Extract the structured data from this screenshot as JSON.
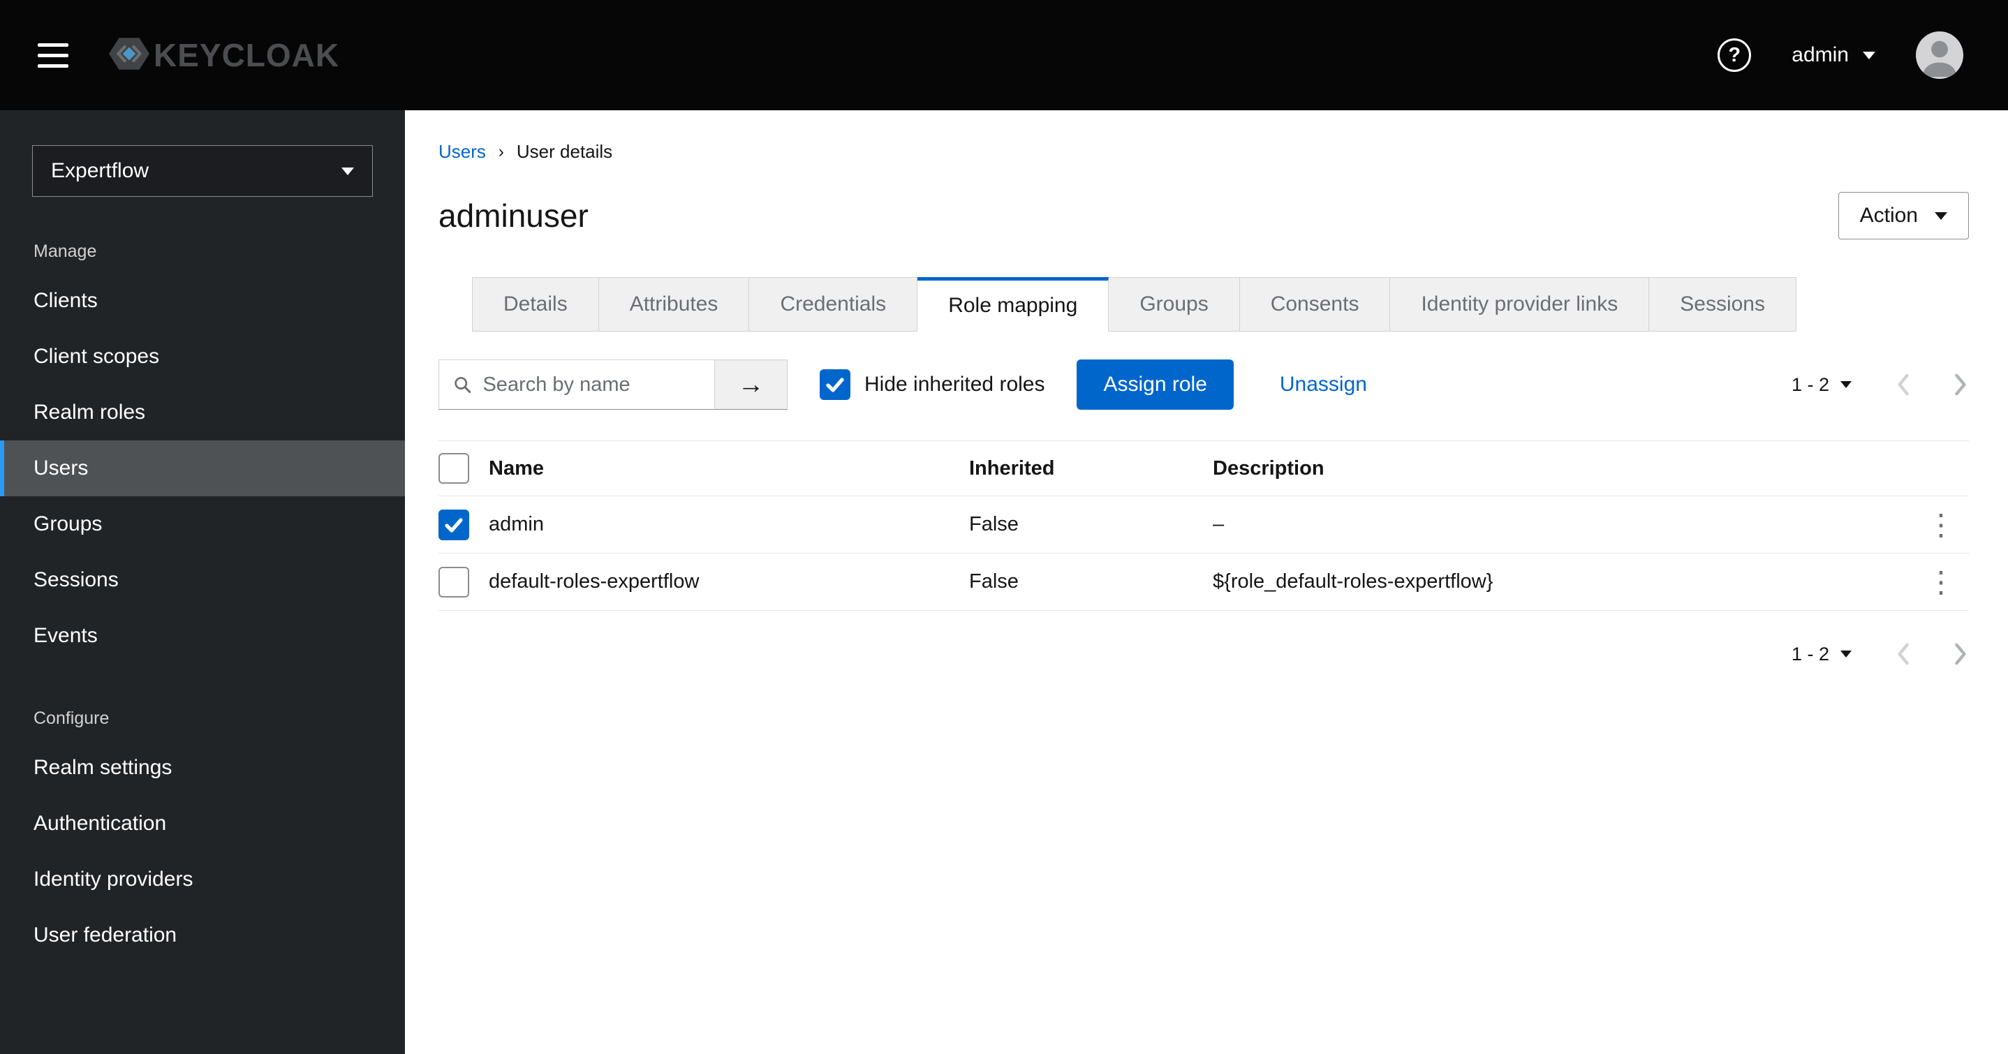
{
  "header": {
    "brand": "KEYCLOAK",
    "user": "admin"
  },
  "icons": {
    "help": "?",
    "search_submit": "→",
    "kebab": "⋮"
  },
  "sidebar": {
    "realm": "Expertflow",
    "sections": [
      {
        "label": "Manage",
        "items": [
          {
            "label": "Clients",
            "current": false
          },
          {
            "label": "Client scopes",
            "current": false
          },
          {
            "label": "Realm roles",
            "current": false
          },
          {
            "label": "Users",
            "current": true
          },
          {
            "label": "Groups",
            "current": false
          },
          {
            "label": "Sessions",
            "current": false
          },
          {
            "label": "Events",
            "current": false
          }
        ]
      },
      {
        "label": "Configure",
        "items": [
          {
            "label": "Realm settings",
            "current": false
          },
          {
            "label": "Authentication",
            "current": false
          },
          {
            "label": "Identity providers",
            "current": false
          },
          {
            "label": "User federation",
            "current": false
          }
        ]
      }
    ]
  },
  "breadcrumb": {
    "separator": "›",
    "items": [
      {
        "label": "Users",
        "link": true
      },
      {
        "label": "User details",
        "link": false
      }
    ]
  },
  "page": {
    "title": "adminuser",
    "action_button": "Action"
  },
  "tabs": [
    {
      "label": "Details",
      "active": false
    },
    {
      "label": "Attributes",
      "active": false
    },
    {
      "label": "Credentials",
      "active": false
    },
    {
      "label": "Role mapping",
      "active": true
    },
    {
      "label": "Groups",
      "active": false
    },
    {
      "label": "Consents",
      "active": false
    },
    {
      "label": "Identity provider links",
      "active": false
    },
    {
      "label": "Sessions",
      "active": false
    }
  ],
  "toolbar": {
    "search_placeholder": "Search by name",
    "hide_inherited": {
      "label": "Hide inherited roles",
      "checked": true
    },
    "assign_button": "Assign role",
    "unassign_link": "Unassign"
  },
  "pagination": {
    "range": "1 - 2"
  },
  "table": {
    "columns": [
      "Name",
      "Inherited",
      "Description"
    ],
    "rows": [
      {
        "selected": true,
        "name": "admin",
        "inherited": "False",
        "description": "–"
      },
      {
        "selected": false,
        "name": "default-roles-expertflow",
        "inherited": "False",
        "description": "${role_default-roles-expertflow}"
      }
    ]
  },
  "colors": {
    "primary": "#0066cc",
    "masthead_bg": "#060606",
    "sidebar_bg": "#212427",
    "nav_current_bg": "#4f5255",
    "nav_current_border": "#2b9af3"
  }
}
